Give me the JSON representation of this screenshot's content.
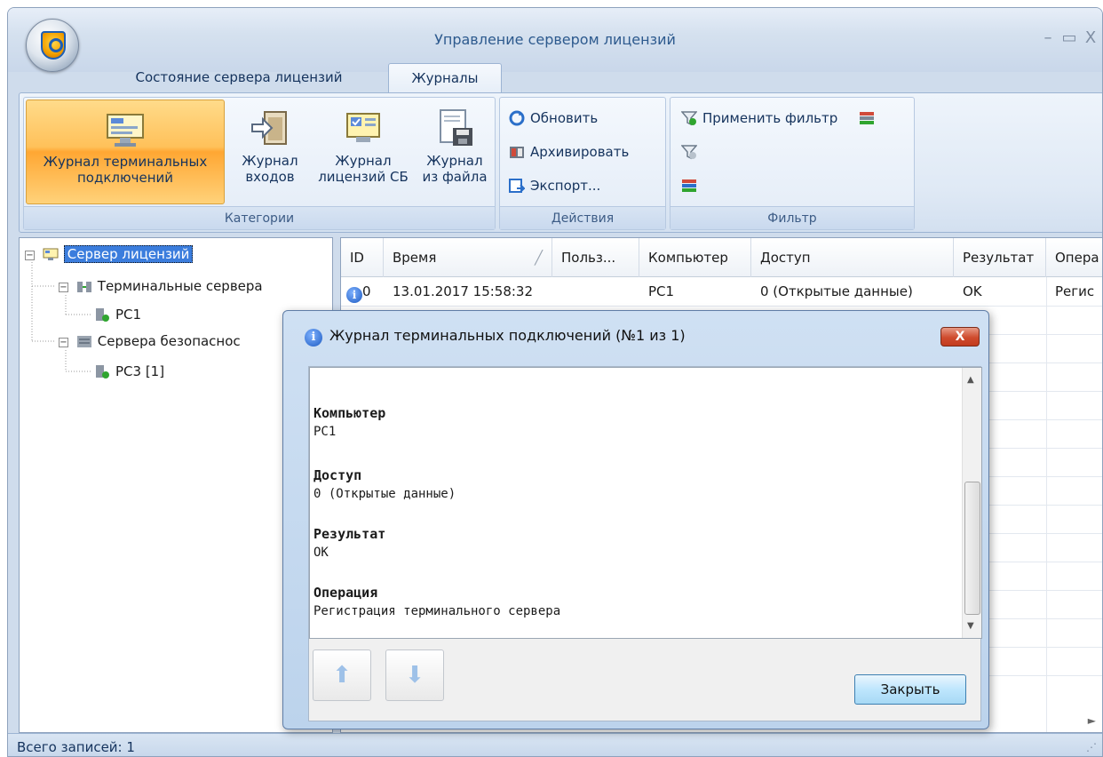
{
  "app": {
    "title": "Управление сервером лицензий",
    "window_controls": [
      "–",
      "▭",
      "X"
    ]
  },
  "tabs": [
    {
      "label": "Состояние сервера лицензий",
      "active": false
    },
    {
      "label": "Журналы",
      "active": true
    }
  ],
  "ribbon": {
    "categories": {
      "label": "Категории",
      "buttons": [
        {
          "line1": "Журнал терминальных",
          "line2": "подключений",
          "icon": "terminal-log-icon",
          "active": true
        },
        {
          "line1": "Журнал",
          "line2": "входов",
          "icon": "login-log-icon",
          "active": false
        },
        {
          "line1": "Журнал",
          "line2": "лицензий СБ",
          "icon": "license-log-icon",
          "active": false
        },
        {
          "line1": "Журнал",
          "line2": "из файла",
          "icon": "file-log-icon",
          "active": false
        }
      ]
    },
    "actions": {
      "label": "Действия",
      "buttons": [
        {
          "label": "Обновить",
          "icon": "refresh-icon"
        },
        {
          "label": "Архивировать",
          "icon": "archive-icon"
        },
        {
          "label": "Экспорт...",
          "icon": "export-icon"
        }
      ]
    },
    "filter": {
      "label": "Фильтр",
      "apply_label": "Применить фильтр"
    }
  },
  "tree": {
    "root": "Сервер лицензий",
    "terminal_servers": "Терминальные сервера",
    "terminal_child": "PC1",
    "security_servers": "Сервера безопаснос",
    "security_child": "PC3 [1]"
  },
  "grid": {
    "columns": [
      "ID",
      "Время",
      "Польз...",
      "Компьютер",
      "Доступ",
      "Результат",
      "Опера"
    ],
    "rows": [
      [
        "0",
        "13.01.2017 15:58:32",
        "",
        "PC1",
        "0 (Открытые данные)",
        "OK",
        "Регис"
      ]
    ]
  },
  "status": {
    "text": "Всего записей: 1"
  },
  "dialog": {
    "title": "Журнал терминальных подключений (№1 из 1)",
    "close_x": "X",
    "fields": [
      {
        "label": "Компьютер",
        "value": "PC1"
      },
      {
        "label": "Доступ",
        "value": "0 (Открытые данные)"
      },
      {
        "label": "Результат",
        "value": "OK"
      },
      {
        "label": "Операция",
        "value": "Регистрация терминального сервера"
      }
    ],
    "close_button": "Закрыть"
  },
  "colors": {
    "accent": "#3b7ddd",
    "active_button": "#ffc15a",
    "title_text": "#2d5a8e"
  }
}
